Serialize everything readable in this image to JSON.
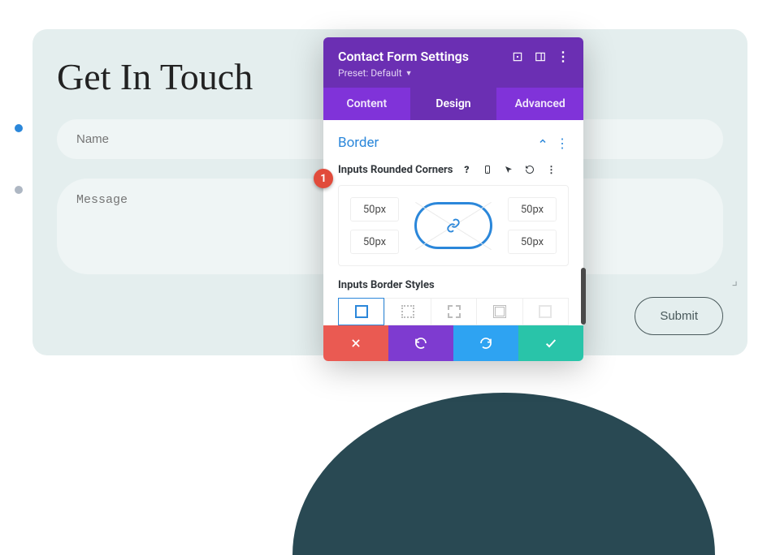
{
  "page": {
    "title": "Get In Touch",
    "name_placeholder": "Name",
    "message_placeholder": "Message",
    "submit_label": "Submit"
  },
  "modal": {
    "title": "Contact Form Settings",
    "preset_label": "Preset: Default",
    "tabs": {
      "content": "Content",
      "design": "Design",
      "advanced": "Advanced"
    },
    "section": {
      "title": "Border",
      "rounded_label": "Inputs Rounded Corners",
      "corners": {
        "tl": "50px",
        "tr": "50px",
        "bl": "50px",
        "br": "50px"
      },
      "styles_label": "Inputs Border Styles"
    },
    "annotation": "1"
  }
}
